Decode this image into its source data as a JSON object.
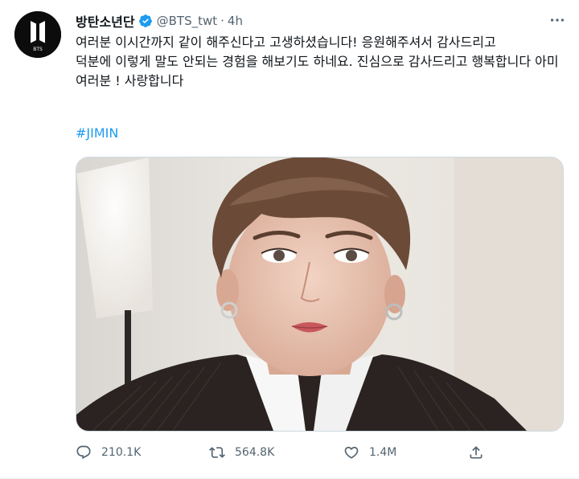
{
  "tweet": {
    "author_name": "방탄소년단",
    "handle": "@BTS_twt",
    "separator": "·",
    "time": "4h",
    "avatar_label": "BTS",
    "text": "여러분 이시간까지 같이 해주신다고 고생하셨습니다! 응원해주셔서 감사드리고\n덕분에 이렇게 말도 안되는 경험을 해보기도 하네요. 진심으로 감사드리고 행복합니다 아미여러분 ! 사랑합니다",
    "hashtag": "#JIMIN"
  },
  "actions": {
    "replies": "210.1K",
    "retweets": "564.8K",
    "likes": "1.4M"
  },
  "icons": [
    "bts-logo-icon",
    "verified-badge-icon",
    "more-icon",
    "reply-icon",
    "retweet-icon",
    "like-icon",
    "share-icon"
  ],
  "colors": {
    "accent": "#1d9bf0",
    "secondary_text": "#536471",
    "primary_text": "#0f1419"
  }
}
